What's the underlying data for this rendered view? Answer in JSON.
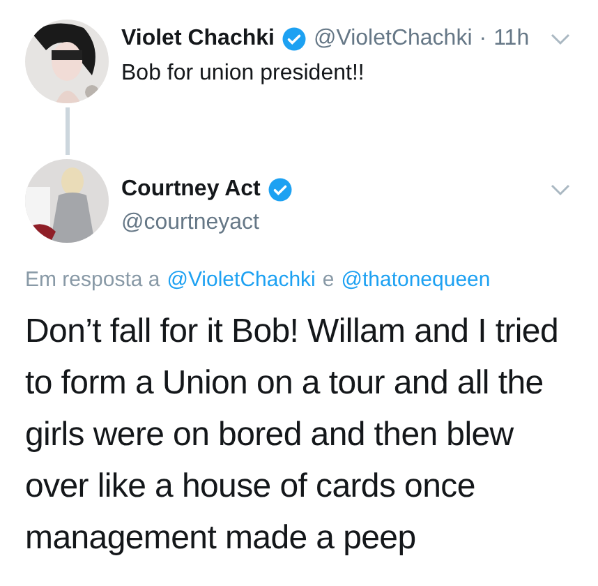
{
  "parent_tweet": {
    "name": "Violet Chachki",
    "verified": true,
    "handle": "@VioletChachki",
    "separator": "·",
    "time": "11h",
    "text": "Bob for union president!!"
  },
  "reply_tweet": {
    "name": "Courtney Act",
    "verified": true,
    "handle": "@courtneyact",
    "reply_prefix": "Em resposta a",
    "reply_mentions": [
      "@VioletChachki",
      "@thatonequeen"
    ],
    "reply_joiner": "e",
    "text": "Don’t fall for it Bob! Willam and I tried to form a Union on a tour and all the girls were on bored and then blew over like a house of cards once management made a peep"
  }
}
